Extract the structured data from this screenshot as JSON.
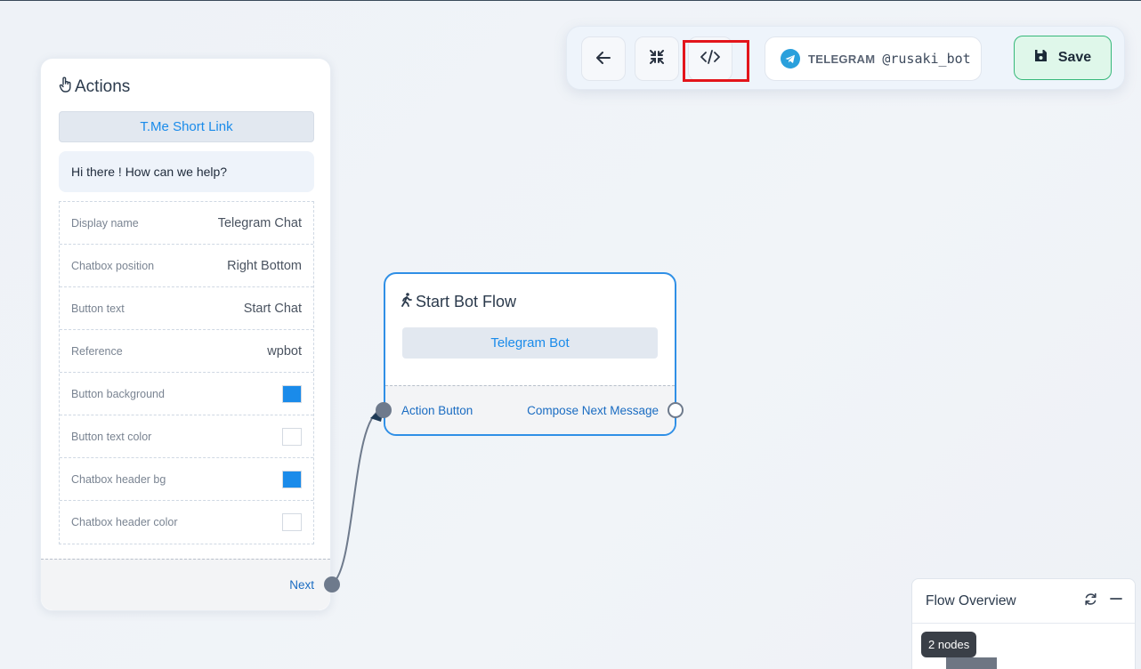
{
  "toolbar": {
    "back_icon": "arrow-left-icon",
    "collapse_icon": "compress-icon",
    "code_icon": "code-icon",
    "platform_label": "TELEGRAM",
    "bot_handle": "@rusaki_bot",
    "save_label": "Save",
    "accent_save": "#36b87a",
    "highlight_color": "#e3151b"
  },
  "actions_node": {
    "title": "Actions",
    "pill_label": "T.Me Short Link",
    "greeting": "Hi there ! How can we help?",
    "properties": [
      {
        "label": "Display name",
        "value": "Telegram Chat"
      },
      {
        "label": "Chatbox position",
        "value": "Right Bottom"
      },
      {
        "label": "Button text",
        "value": "Start Chat"
      },
      {
        "label": "Reference",
        "value": "wpbot"
      },
      {
        "label": "Button background",
        "color": "#1a8bea"
      },
      {
        "label": "Button text color",
        "color": "#ffffff"
      },
      {
        "label": "Chatbox header bg",
        "color": "#1a8bea"
      },
      {
        "label": "Chatbox header color",
        "color": "#ffffff"
      }
    ],
    "footer_label": "Next"
  },
  "start_node": {
    "title": "Start Bot Flow",
    "pill_label": "Telegram Bot",
    "left_output": "Action Button",
    "right_output": "Compose Next Message"
  },
  "overview": {
    "title": "Flow Overview",
    "node_count": "2 nodes"
  }
}
